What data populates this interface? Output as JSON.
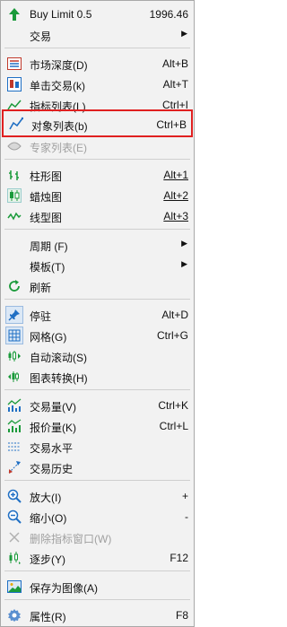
{
  "menu": {
    "buy_limit": {
      "label": "Buy Limit 0.5",
      "price": "1996.46"
    },
    "trade": {
      "label": "交易"
    },
    "market_depth": {
      "label": "市场深度(D)",
      "shortcut": "Alt+B"
    },
    "one_click": {
      "label": "单击交易(k)",
      "shortcut": "Alt+T"
    },
    "indicator_list": {
      "label": "指标列表(L)",
      "shortcut": "Ctrl+I"
    },
    "object_list": {
      "label": "对象列表(b)",
      "shortcut": "Ctrl+B"
    },
    "expert_list": {
      "label": "专家列表(E)"
    },
    "bar_chart": {
      "label": "柱形图",
      "shortcut": "Alt+1"
    },
    "candle_chart": {
      "label": "蜡烛图",
      "shortcut": "Alt+2"
    },
    "line_chart": {
      "label": "线型图",
      "shortcut": "Alt+3"
    },
    "period": {
      "label": "周期 (F)"
    },
    "template": {
      "label": "模板(T)"
    },
    "refresh": {
      "label": "刷新"
    },
    "dock": {
      "label": "停驻",
      "shortcut": "Alt+D"
    },
    "grid": {
      "label": "网格(G)",
      "shortcut": "Ctrl+G"
    },
    "auto_scroll": {
      "label": "自动滚动(S)"
    },
    "chart_shift": {
      "label": "图表转换(H)"
    },
    "volume": {
      "label": "交易量(V)",
      "shortcut": "Ctrl+K"
    },
    "tick_volume": {
      "label": "报价量(K)",
      "shortcut": "Ctrl+L"
    },
    "trade_levels": {
      "label": "交易水平"
    },
    "trade_history": {
      "label": "交易历史"
    },
    "zoom_in": {
      "label": "放大(I)",
      "shortcut": "+"
    },
    "zoom_out": {
      "label": "缩小(O)",
      "shortcut": "-"
    },
    "delete_indicator_window": {
      "label": "删除指标窗口(W)"
    },
    "step_by_step": {
      "label": "逐步(Y)",
      "shortcut": "F12"
    },
    "save_image": {
      "label": "保存为图像(A)"
    },
    "properties": {
      "label": "属性(R)",
      "shortcut": "F8"
    }
  },
  "icons": {
    "buy_limit": "arrow-up-icon",
    "market_depth": "market-depth-icon",
    "one_click": "one-click-trading-icon",
    "indicator_list": "indicator-list-icon",
    "object_list": "object-list-icon",
    "expert_list": "expert-list-icon",
    "bar_chart": "bar-chart-icon",
    "candle_chart": "candlestick-icon",
    "line_chart": "line-chart-icon",
    "refresh": "refresh-icon",
    "dock": "pin-icon",
    "grid": "grid-icon",
    "auto_scroll": "auto-scroll-icon",
    "chart_shift": "chart-shift-icon",
    "volume": "volume-icon",
    "tick_volume": "tick-volume-icon",
    "trade_levels": "trade-levels-icon",
    "trade_history": "trade-history-icon",
    "zoom_in": "zoom-in-icon",
    "zoom_out": "zoom-out-icon",
    "delete_indicator_window": "close-icon",
    "step_by_step": "step-icon",
    "save_image": "image-icon",
    "properties": "settings-icon"
  },
  "colors": {
    "highlight_border": "#e02020",
    "menu_bg": "#f2f2f2",
    "accent_green": "#1a9a3a",
    "accent_blue": "#1f6fc4"
  }
}
